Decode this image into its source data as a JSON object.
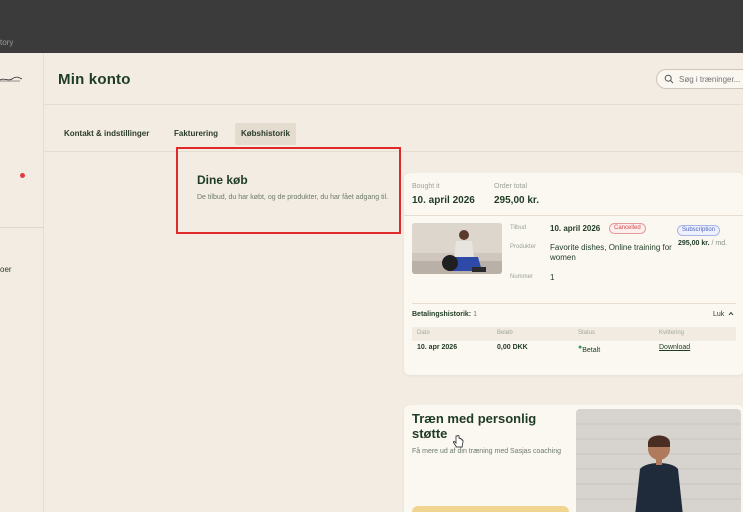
{
  "app": {
    "window_title_fragment": "tory"
  },
  "sidebar": {
    "partial_item_label": "oer"
  },
  "header": {
    "title": "Min konto",
    "search_placeholder": "Søg i træninger..."
  },
  "tabs": [
    {
      "label": "Kontakt & indstillinger",
      "active": false
    },
    {
      "label": "Fakturering",
      "active": false
    },
    {
      "label": "Købshistorik",
      "active": true
    }
  ],
  "intro": {
    "title": "Dine køb",
    "description": "De tilbud, du har købt, og de produkter, du har fået adgang til."
  },
  "order": {
    "bought_label": "Bought it",
    "bought_value": "10. april 2026",
    "total_label": "Order total",
    "total_value": "295,00 kr.",
    "offer_label": "Tilbud",
    "offer_date": "10. april 2026",
    "status_badge": "Cancelled",
    "type_badge": "Subscription",
    "price": "295,00 kr.",
    "price_period": "/ md.",
    "products_label": "Produkter",
    "products_value": "Favorite dishes,  Online training for women",
    "number_label": "Nummer",
    "number_value": "1",
    "payment_history": {
      "title": "Betalingshistorik:",
      "count": "1",
      "close_label": "Luk",
      "columns": [
        "Dato",
        "Beløb",
        "Status",
        "Kvittering"
      ],
      "rows": [
        {
          "date": "10. apr 2026",
          "amount": "0,00 DKK",
          "status": "Betalt",
          "receipt": "Download"
        }
      ]
    }
  },
  "promo": {
    "title": "Træn med personlig støtte",
    "description": "Få mere ud af din træning med Sasjas coaching"
  },
  "colors": {
    "brand_green": "#1e3b24",
    "highlight_red": "#e02a2a",
    "paid_green": "#2e9a52",
    "promo_button": "#f0d590"
  }
}
